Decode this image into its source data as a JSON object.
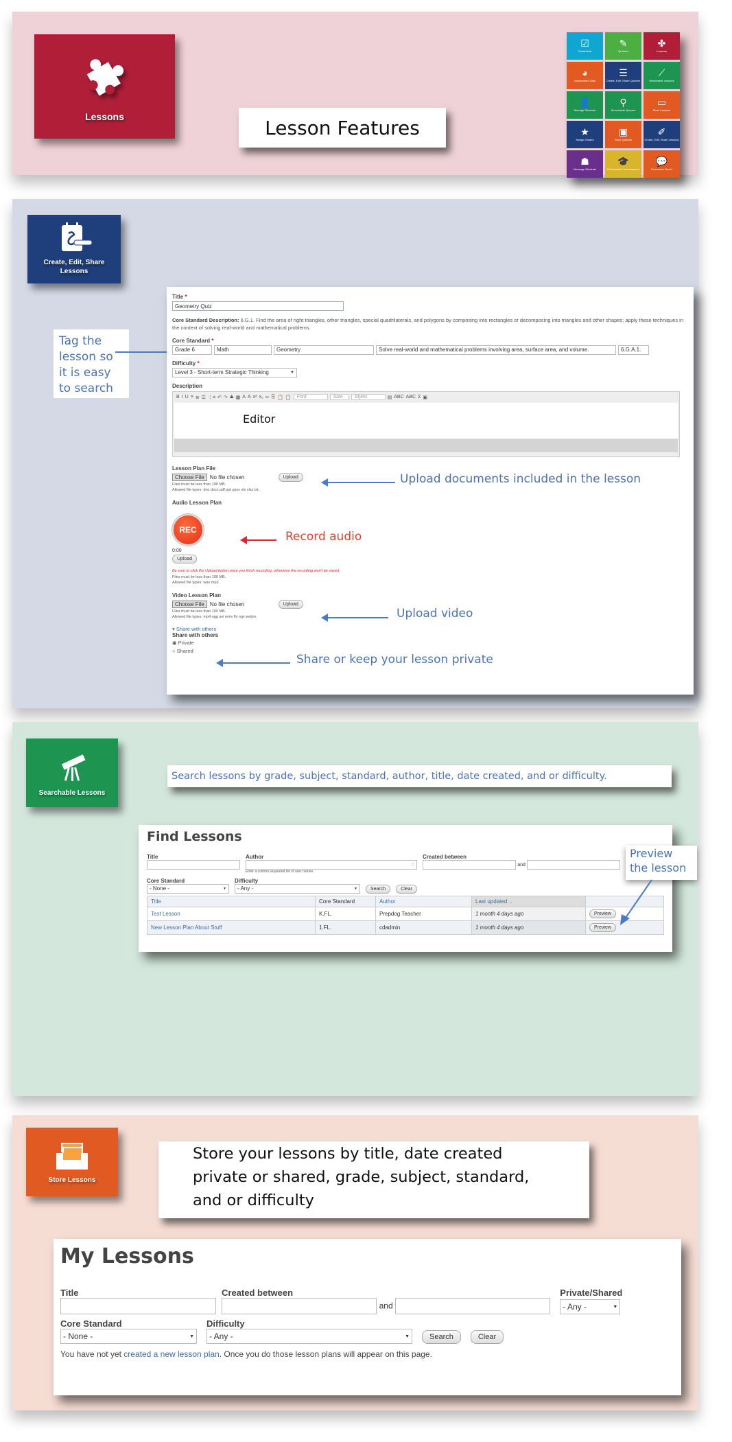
{
  "header": {
    "tile_label": "Lessons",
    "tile_icon": "puzzle-icon",
    "tile_color": "#b01e38",
    "title": "Lesson Features",
    "app_tiles": [
      {
        "label": "Gradebook",
        "icon": "checkbox-icon",
        "glyph": "☑",
        "color": "#0fa7d2"
      },
      {
        "label": "Quizzes",
        "icon": "edit-icon",
        "glyph": "✎",
        "color": "#4caf42"
      },
      {
        "label": "Lessons",
        "icon": "puzzle-icon",
        "glyph": "✤",
        "color": "#b01e38"
      },
      {
        "label": "Assessment Data",
        "icon": "pie-chart-icon",
        "glyph": "◕",
        "color": "#e05a22"
      },
      {
        "label": "Create, Edit, Share Quizzes",
        "icon": "notepad-icon",
        "glyph": "☰",
        "color": "#1f3f7c"
      },
      {
        "label": "Searchable Lessons",
        "icon": "telescope-icon",
        "glyph": "⟋",
        "color": "#1d9450"
      },
      {
        "label": "Manage Students",
        "icon": "users-icon",
        "glyph": "👤",
        "color": "#1d9450"
      },
      {
        "label": "Searchable Quizzes",
        "icon": "search-icon",
        "glyph": "⚲",
        "color": "#1d9450"
      },
      {
        "label": "Store Lessons",
        "icon": "inbox-icon",
        "glyph": "▭",
        "color": "#e05a22"
      },
      {
        "label": "Assign Grades",
        "icon": "star-icon",
        "glyph": "★",
        "color": "#1f3f7c"
      },
      {
        "label": "Store Quizzes",
        "icon": "box-icon",
        "glyph": "▣",
        "color": "#e05a22"
      },
      {
        "label": "Create, Edit, Share Lessons",
        "icon": "calendar-pen-icon",
        "glyph": "✐",
        "color": "#1f3f7c"
      },
      {
        "label": "Message Students",
        "icon": "contact-icon",
        "glyph": "☗",
        "color": "#6a2f8c"
      },
      {
        "label": "Professional Development",
        "icon": "graduation-cap-icon",
        "glyph": "🎓",
        "color": "#d8b52a"
      },
      {
        "label": "Discussion Board",
        "icon": "chat-bubble-icon",
        "glyph": "💬",
        "color": "#e05a22"
      }
    ]
  },
  "create": {
    "tile_label": "Create, Edit, Share Lessons",
    "tile_color": "#1f3f7c",
    "callout_tag": "Tag the lesson so it is easy to search",
    "callout_upload_docs": "Upload documents included in the lesson",
    "callout_record": "Record audio",
    "callout_upload_video": "Upload video",
    "callout_share": "Share or keep your lesson private",
    "editor_overlay": "Editor",
    "form": {
      "title_label": "Title",
      "title_value": "Geometry Quiz",
      "core_desc_label": "Core Standard Description:",
      "core_desc_text": "6.G.1. Find the area of right triangles, other triangles, special quadrilaterals, and polygons by composing into rectangles or decomposing into triangles and other shapes; apply these techniques in the context of solving real-world and mathematical problems.",
      "core_standard_label": "Core Standard",
      "core_standard_values": [
        "Grade 6",
        "Math",
        "Geometry",
        "Solve real-world and mathematical problems involving area, surface area, and volume.",
        "6.G.A.1."
      ],
      "difficulty_label": "Difficulty",
      "difficulty_value": "Level 3 - Short-term Strategic Thinking",
      "description_label": "Description",
      "toolbar": {
        "font_label": "Font",
        "size_label": "Size",
        "styles_label": "Styles",
        "buttons": [
          "B",
          "I",
          "U",
          "≡",
          "≣",
          "☰",
          "⋮≡",
          "↶",
          "↷",
          "⛰",
          "▦",
          "A",
          "A",
          "x²",
          "x₂",
          "✂",
          "⎘",
          "📋",
          "📋"
        ],
        "extra_buttons": [
          "▤",
          "ABC",
          "ABC",
          "Σ",
          "▣"
        ]
      },
      "lesson_file_label": "Lesson Plan File",
      "choose_file": "Choose File",
      "no_file": "No file chosen",
      "upload": "Upload",
      "size_limit": "Files must be less than 100 MB.",
      "lesson_file_types": "Allowed file types: doc docx pdf ppt ppsx xls xlsx txt.",
      "audio_label": "Audio Lesson Plan",
      "rec_label": "REC",
      "audio_time": "0:00",
      "audio_warning": "Be sure to click the Upload button once you finish recording, otherwise the recording won't be saved.",
      "audio_file_types": "Allowed file types: wav mp3.",
      "video_label": "Video Lesson Plan",
      "video_file_types": "Allowed file types: mp4 ogg avi wmv flv ogv webm.",
      "share_toggle": "Share with others",
      "share_label": "Share with others",
      "share_options": [
        "Private",
        "Shared"
      ],
      "share_selected": "Private"
    }
  },
  "search": {
    "tile_label": "Searchable Lessons",
    "tile_color": "#1d9450",
    "callout": "Search lessons by grade, subject, standard, author, title, date created, and or difficulty.",
    "callout_preview": "Preview the lesson",
    "page_title": "Find Lessons",
    "title_label": "Title",
    "author_label": "Author",
    "author_help": "Enter a comma separated list of user names.",
    "created_label": "Created between",
    "and_label": "and",
    "core_label": "Core Standard",
    "core_value": "- None -",
    "difficulty_label": "Difficulty",
    "difficulty_value": "- Any -",
    "search_btn": "Search",
    "clear_btn": "Clear",
    "columns": [
      "Title",
      "Core Standard",
      "Author",
      "Last updated",
      ""
    ],
    "rows": [
      {
        "title": "Test Lesson",
        "core": "K.FL.",
        "author": "Prepdog Teacher",
        "updated": "1 month 4 days ago",
        "action": "Preview"
      },
      {
        "title": "New Lesson Plan About Stuff",
        "core": "1.FL.",
        "author": "cdadmin",
        "updated": "1 month 4 days ago",
        "action": "Preview"
      }
    ]
  },
  "store": {
    "tile_label": "Store Lessons",
    "tile_color": "#e05a22",
    "callout": "Store your lessons by title, date created private or shared, grade, subject, standard, and or difficulty",
    "page_title": "My Lessons",
    "title_label": "Title",
    "created_label": "Created between",
    "and_label": "and",
    "private_shared_label": "Private/Shared",
    "private_shared_value": "- Any -",
    "core_label": "Core Standard",
    "core_value": "- None -",
    "difficulty_label": "Difficulty",
    "difficulty_value": "- Any -",
    "search_btn": "Search",
    "clear_btn": "Clear",
    "empty_prefix": "You have not yet ",
    "empty_link": "created a new lesson plan",
    "empty_suffix": ". Once you do those lesson plans will appear on this page."
  }
}
